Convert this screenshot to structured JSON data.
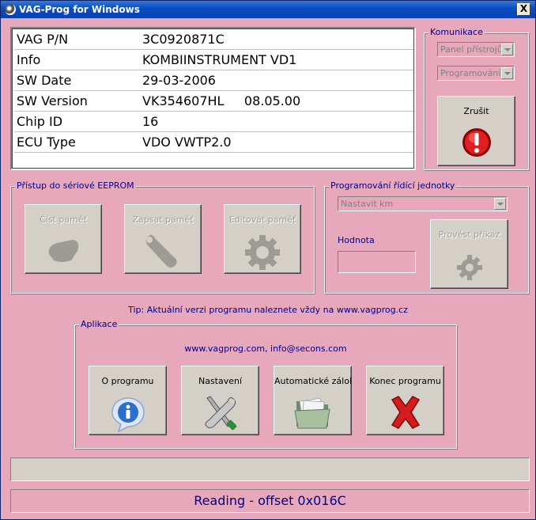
{
  "window": {
    "title": "VAG-Prog for Windows",
    "close_label": "X"
  },
  "info": [
    {
      "key": "VAG P/N",
      "value": "3C0920871C"
    },
    {
      "key": "Info",
      "value": "KOMBIINSTRUMENT VD1"
    },
    {
      "key": "SW Date",
      "value": "29-03-2006"
    },
    {
      "key": "SW Version",
      "value": "VK354607HL     08.05.00"
    },
    {
      "key": "Chip ID",
      "value": "16"
    },
    {
      "key": "ECU Type",
      "value": "VDO VWTP2.0"
    }
  ],
  "komunikace": {
    "legend": "Komunikace",
    "select1": "Panel přístrojů",
    "select2": "Programování",
    "cancel_label": "Zrušit"
  },
  "eeprom": {
    "legend": "Přístup do sériové EEPROM",
    "read_label": "Číst paměť",
    "write_label": "Zapsat paměť",
    "edit_label": "Editovat paměť"
  },
  "programming": {
    "legend": "Programování řídící jednotky",
    "select": "Nastavit km",
    "value_label": "Hodnota",
    "value": "",
    "execute_label": "Provést příkaz"
  },
  "tip": "Tip: Aktuální verzi programu naleznete vždy na www.vagprog.cz",
  "aplikace": {
    "legend": "Aplikace",
    "contact": "www.vagprog.com, info@secons.com",
    "about_label": "O programu",
    "settings_label": "Nastavení",
    "backup_label": "Automatické zálohy",
    "exit_label": "Konec programu"
  },
  "progress": {
    "percent": 0
  },
  "status": "Reading - offset 0x016C",
  "colors": {
    "background": "#e8a8bc",
    "button": "#d4d0c8",
    "label_blue": "#00008b"
  }
}
